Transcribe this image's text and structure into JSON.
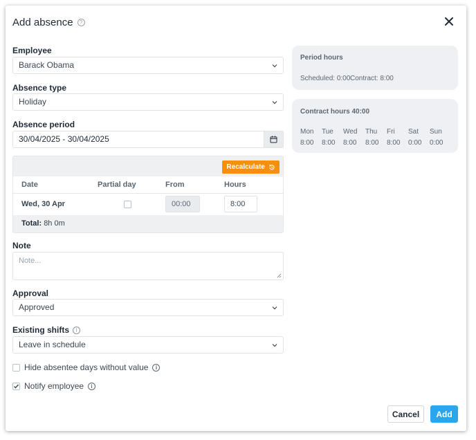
{
  "dialog": {
    "title": "Add absence",
    "help_icon": "question-circle-icon",
    "close_icon": "close-icon"
  },
  "employee": {
    "label": "Employee",
    "value": "Barack Obama"
  },
  "absence_type": {
    "label": "Absence type",
    "value": "Holiday"
  },
  "absence_period": {
    "label": "Absence period",
    "value": "30/04/2025 - 30/04/2025",
    "icon": "calendar-icon"
  },
  "table": {
    "recalculate_label": "Recalculate",
    "headers": {
      "date": "Date",
      "partial_day": "Partial day",
      "from": "From",
      "hours": "Hours"
    },
    "rows": [
      {
        "date": "Wed, 30 Apr",
        "from": "00:00",
        "hours": "8:00"
      }
    ],
    "total_label": "Total:",
    "total_value": "8h 0m"
  },
  "note": {
    "label": "Note",
    "placeholder": "Note..."
  },
  "approval": {
    "label": "Approval",
    "value": "Approved"
  },
  "existing_shifts": {
    "label": "Existing shifts",
    "value": "Leave in schedule"
  },
  "hide_absentee": {
    "label": "Hide absentee days without value"
  },
  "notify_employee": {
    "label": "Notify employee"
  },
  "period_hours": {
    "title": "Period hours",
    "scheduled": "Scheduled: 0:00",
    "contract": "Contract: 8:00"
  },
  "contract_hours": {
    "title": "Contract hours 40:00",
    "days": [
      {
        "day": "Mon",
        "hours": "8:00"
      },
      {
        "day": "Tue",
        "hours": "8:00"
      },
      {
        "day": "Wed",
        "hours": "8:00"
      },
      {
        "day": "Thu",
        "hours": "8:00"
      },
      {
        "day": "Fri",
        "hours": "8:00"
      },
      {
        "day": "Sat",
        "hours": "0:00"
      },
      {
        "day": "Sun",
        "hours": "0:00"
      }
    ]
  },
  "footer": {
    "cancel_label": "Cancel",
    "add_label": "Add"
  },
  "colors": {
    "accent": "#2aa6ec",
    "recalculate": "#f5900f"
  }
}
